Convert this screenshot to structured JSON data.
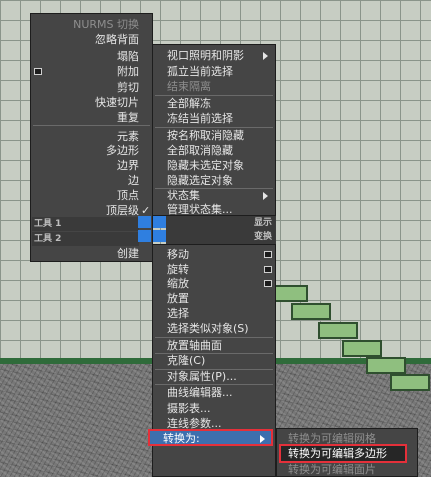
{
  "left_quad": {
    "top_section": [
      "NURMS 切换",
      "忽略背面",
      "塌陷",
      "附加",
      "剪切",
      "快速切片",
      "重复"
    ],
    "levels": [
      "元素",
      "多边形",
      "边界",
      "边",
      "顶点",
      "顶层级"
    ],
    "tools": [
      "工具 1",
      "工具 2"
    ],
    "display_labels": [
      "显示",
      "变换"
    ],
    "bottom": "创建"
  },
  "right_quad": {
    "display": [
      "视口照明和阴影",
      "孤立当前选择",
      "结束隔离",
      "全部解冻",
      "冻结当前选择",
      "按名称取消隐藏",
      "全部取消隐藏",
      "隐藏未选定对象",
      "隐藏选定对象",
      "状态集",
      "管理状态集..."
    ],
    "transform": [
      "移动",
      "旋转",
      "缩放",
      "放置",
      "选择",
      "选择类似对象(S)",
      "放置轴曲面",
      "克隆(C)",
      "对象属性(P)...",
      "曲线编辑器...",
      "摄影表...",
      "连线参数...",
      "转换为:"
    ]
  },
  "submenu": [
    "转换为可编辑网格",
    "转换为可编辑多边形",
    "转换为可编辑面片"
  ],
  "colors": {
    "menu_bg": "#454545",
    "highlight": "#3d6fae",
    "callout": "#e5303a"
  }
}
